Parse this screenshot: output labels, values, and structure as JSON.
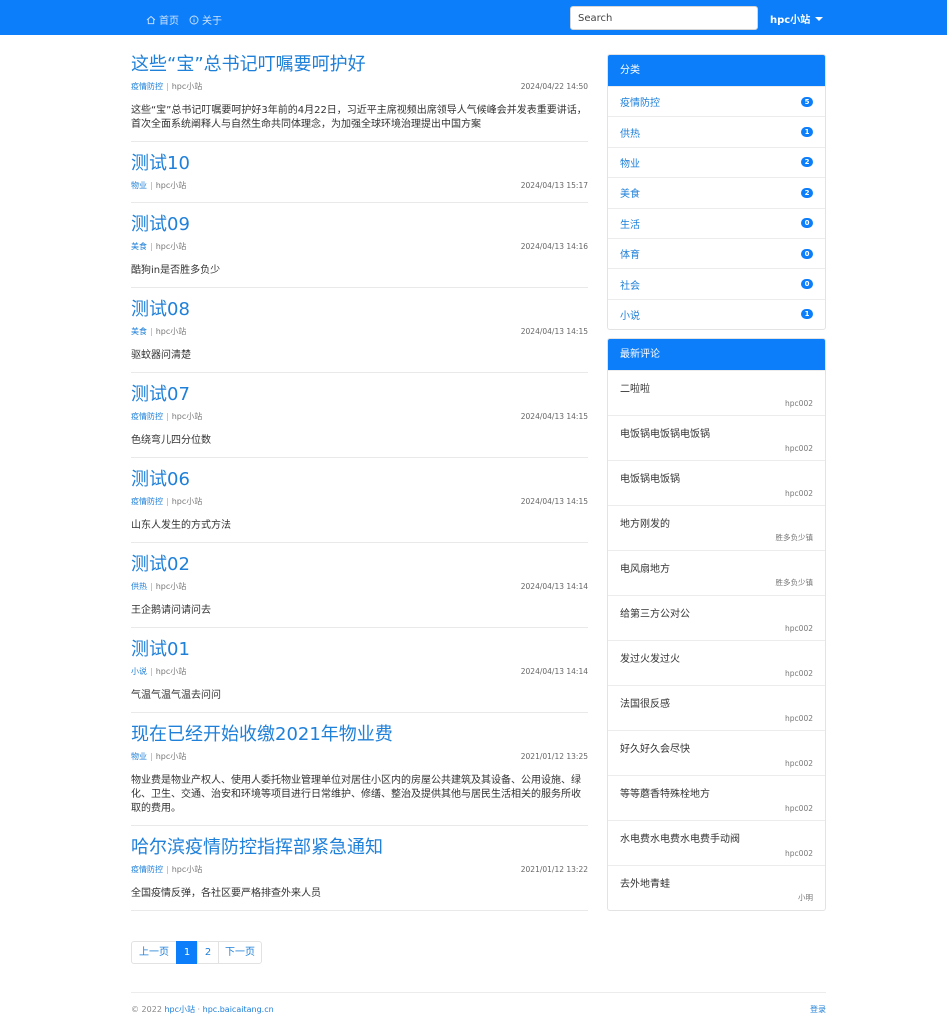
{
  "nav": {
    "home_label": "首页",
    "about_label": "关于",
    "search_placeholder": "Search",
    "user_label": "hpc小站"
  },
  "posts": [
    {
      "title": "这些“宝”总书记叮嘱要呵护好",
      "category": "疫情防控",
      "author": "hpc小站",
      "date": "2024/04/22 14:50",
      "excerpt": "这些“宝”总书记叮嘱要呵护好3年前的4月22日，习近平主席视频出席领导人气候峰会并发表重要讲话，首次全面系统阐释人与自然生命共同体理念，为加强全球环境治理提出中国方案"
    },
    {
      "title": "测试10",
      "category": "物业",
      "author": "hpc小站",
      "date": "2024/04/13 15:17",
      "excerpt": ""
    },
    {
      "title": "测试09",
      "category": "美食",
      "author": "hpc小站",
      "date": "2024/04/13 14:16",
      "excerpt": "酷狗in是否胜多负少"
    },
    {
      "title": "测试08",
      "category": "美食",
      "author": "hpc小站",
      "date": "2024/04/13 14:15",
      "excerpt": "驱蚊器问清楚"
    },
    {
      "title": "测试07",
      "category": "疫情防控",
      "author": "hpc小站",
      "date": "2024/04/13 14:15",
      "excerpt": "色绕弯儿四分位数"
    },
    {
      "title": "测试06",
      "category": "疫情防控",
      "author": "hpc小站",
      "date": "2024/04/13 14:15",
      "excerpt": "山东人发生的方式方法"
    },
    {
      "title": "测试02",
      "category": "供热",
      "author": "hpc小站",
      "date": "2024/04/13 14:14",
      "excerpt": "王企鹅请问请问去"
    },
    {
      "title": "测试01",
      "category": "小说",
      "author": "hpc小站",
      "date": "2024/04/13 14:14",
      "excerpt": "气温气温气温去问问"
    },
    {
      "title": "现在已经开始收缴2021年物业费",
      "category": "物业",
      "author": "hpc小站",
      "date": "2021/01/12 13:25",
      "excerpt": "物业费是物业产权人、使用人委托物业管理单位对居住小区内的房屋公共建筑及其设备、公用设施、绿化、卫生、交通、治安和环境等项目进行日常维护、修缮、整治及提供其他与居民生活相关的服务所收取的费用。"
    },
    {
      "title": "哈尔滨疫情防控指挥部紧急通知",
      "category": "疫情防控",
      "author": "hpc小站",
      "date": "2021/01/12 13:22",
      "excerpt": "全国疫情反弹，各社区要严格排查外来人员"
    }
  ],
  "pagination": {
    "prev": "上一页",
    "pages": [
      "1",
      "2"
    ],
    "next": "下一页",
    "current": "1"
  },
  "sidebar": {
    "categories_title": "分类",
    "categories": [
      {
        "name": "疫情防控",
        "count": "5"
      },
      {
        "name": "供热",
        "count": "1"
      },
      {
        "name": "物业",
        "count": "2"
      },
      {
        "name": "美食",
        "count": "2"
      },
      {
        "name": "生活",
        "count": "0"
      },
      {
        "name": "体育",
        "count": "0"
      },
      {
        "name": "社会",
        "count": "0"
      },
      {
        "name": "小说",
        "count": "1"
      }
    ],
    "comments_title": "最新评论",
    "comments": [
      {
        "text": "二啦啦",
        "user": "hpc002"
      },
      {
        "text": "电饭锅电饭锅电饭锅",
        "user": "hpc002"
      },
      {
        "text": "电饭锅电饭锅",
        "user": "hpc002"
      },
      {
        "text": "地方刚发的",
        "user": "胜多负少镇"
      },
      {
        "text": "电风扇地方",
        "user": "胜多负少镇"
      },
      {
        "text": "给第三方公对公",
        "user": "hpc002"
      },
      {
        "text": "发过火发过火",
        "user": "hpc002"
      },
      {
        "text": "法国很反感",
        "user": "hpc002"
      },
      {
        "text": "好久好久会尽快",
        "user": "hpc002"
      },
      {
        "text": "等等蘑香特殊栓地方",
        "user": "hpc002"
      },
      {
        "text": "水电费水电费水电费手动阀",
        "user": "hpc002"
      },
      {
        "text": "去外地青蛙",
        "user": "小明"
      }
    ]
  },
  "footer": {
    "copyright": "© 2022",
    "site_name": "hpc小站",
    "separator": "·",
    "domain": "hpc.baicaitang.cn",
    "login": "登录"
  },
  "colors": {
    "primary": "#0d7ef9",
    "link": "#1f80d9"
  }
}
